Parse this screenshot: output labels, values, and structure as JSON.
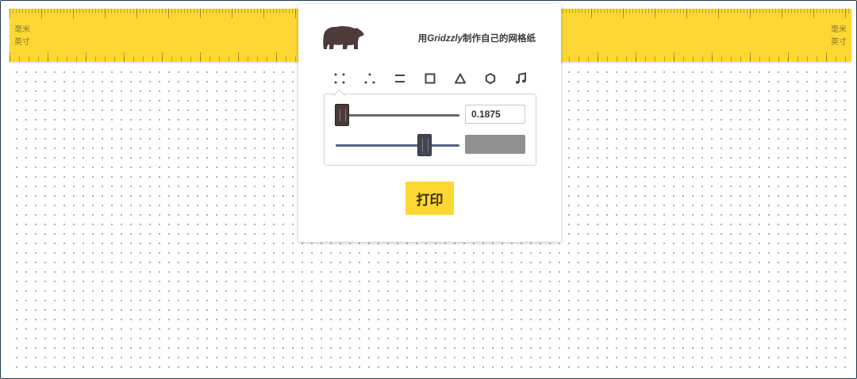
{
  "app": {
    "tagline_prefix": "用",
    "brand": "Gridzzly",
    "tagline_suffix": "制作自己的网格纸"
  },
  "rulers": {
    "mm_label": "毫米",
    "inch_label": "英寸"
  },
  "pattern_tabs": [
    {
      "name": "dots",
      "icon": "dot-grid-icon"
    },
    {
      "name": "triangular-dots",
      "icon": "triangle-dots-icon"
    },
    {
      "name": "lines",
      "icon": "lines-icon"
    },
    {
      "name": "squares",
      "icon": "square-icon"
    },
    {
      "name": "triangles",
      "icon": "triangle-icon"
    },
    {
      "name": "hexagons",
      "icon": "hexagon-icon"
    },
    {
      "name": "music",
      "icon": "music-note-icon"
    }
  ],
  "selected_pattern": "dots",
  "settings": {
    "size_value": "0.1875",
    "size_slider_fraction": 0.05,
    "opacity_slider_fraction": 0.72,
    "line_color": "#909090"
  },
  "print_button": {
    "label": "打印"
  },
  "colors": {
    "accent": "#fdd835",
    "bear": "#4d3a3b"
  }
}
